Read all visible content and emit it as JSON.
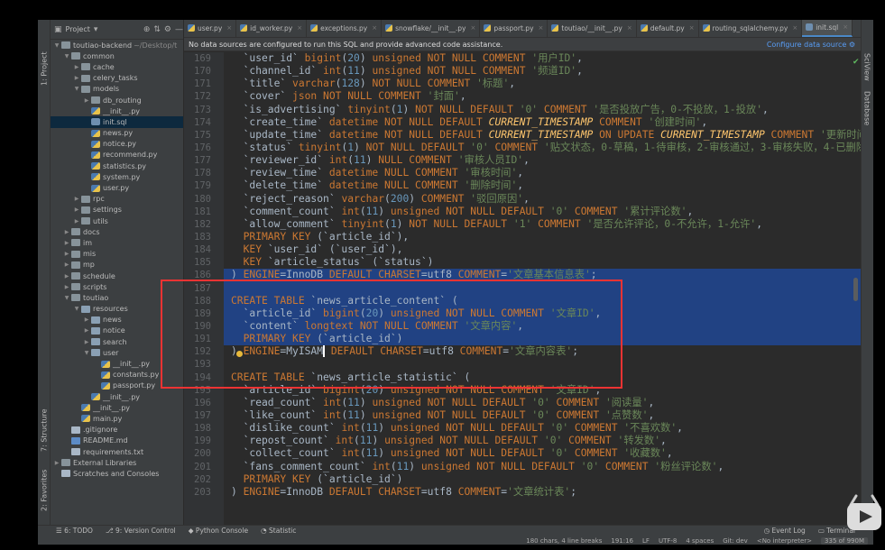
{
  "sidebar_vtabs": {
    "project": "1: Project",
    "structure": "7: Structure",
    "favorites": "2: Favorites"
  },
  "right_vtabs": {
    "sciview": "SciView",
    "database": "Database"
  },
  "project": {
    "title": "Project",
    "tree": [
      {
        "label": "toutiao-backend",
        "suffix": "~/Desktop/t",
        "depth": 0,
        "arrow": "open",
        "icon": "folder"
      },
      {
        "label": "common",
        "depth": 1,
        "arrow": "open",
        "icon": "folder"
      },
      {
        "label": "cache",
        "depth": 2,
        "arrow": "closed",
        "icon": "folder"
      },
      {
        "label": "celery_tasks",
        "depth": 2,
        "arrow": "closed",
        "icon": "folder"
      },
      {
        "label": "models",
        "depth": 2,
        "arrow": "open",
        "icon": "folder"
      },
      {
        "label": "db_routing",
        "depth": 3,
        "arrow": "closed",
        "icon": "folder"
      },
      {
        "label": "__init__.py",
        "depth": 3,
        "arrow": "",
        "icon": "py"
      },
      {
        "label": "init.sql",
        "depth": 3,
        "arrow": "",
        "icon": "sql",
        "selected": true
      },
      {
        "label": "news.py",
        "depth": 3,
        "arrow": "",
        "icon": "py"
      },
      {
        "label": "notice.py",
        "depth": 3,
        "arrow": "",
        "icon": "py"
      },
      {
        "label": "recommend.py",
        "depth": 3,
        "arrow": "",
        "icon": "py"
      },
      {
        "label": "statistics.py",
        "depth": 3,
        "arrow": "",
        "icon": "py"
      },
      {
        "label": "system.py",
        "depth": 3,
        "arrow": "",
        "icon": "py"
      },
      {
        "label": "user.py",
        "depth": 3,
        "arrow": "",
        "icon": "py"
      },
      {
        "label": "rpc",
        "depth": 2,
        "arrow": "closed",
        "icon": "folder"
      },
      {
        "label": "settings",
        "depth": 2,
        "arrow": "closed",
        "icon": "folder"
      },
      {
        "label": "utils",
        "depth": 2,
        "arrow": "closed",
        "icon": "folder"
      },
      {
        "label": "docs",
        "depth": 1,
        "arrow": "closed",
        "icon": "folder"
      },
      {
        "label": "im",
        "depth": 1,
        "arrow": "closed",
        "icon": "folder"
      },
      {
        "label": "mis",
        "depth": 1,
        "arrow": "closed",
        "icon": "folder"
      },
      {
        "label": "mp",
        "depth": 1,
        "arrow": "closed",
        "icon": "folder"
      },
      {
        "label": "schedule",
        "depth": 1,
        "arrow": "closed",
        "icon": "folder"
      },
      {
        "label": "scripts",
        "depth": 1,
        "arrow": "closed",
        "icon": "folder"
      },
      {
        "label": "toutiao",
        "depth": 1,
        "arrow": "open",
        "icon": "folder"
      },
      {
        "label": "resources",
        "depth": 2,
        "arrow": "open",
        "icon": "pkg"
      },
      {
        "label": "news",
        "depth": 3,
        "arrow": "closed",
        "icon": "pkg"
      },
      {
        "label": "notice",
        "depth": 3,
        "arrow": "closed",
        "icon": "pkg"
      },
      {
        "label": "search",
        "depth": 3,
        "arrow": "closed",
        "icon": "pkg"
      },
      {
        "label": "user",
        "depth": 3,
        "arrow": "open",
        "icon": "pkg"
      },
      {
        "label": "__init__.py",
        "depth": 4,
        "arrow": "",
        "icon": "py"
      },
      {
        "label": "constants.py",
        "depth": 4,
        "arrow": "",
        "icon": "py"
      },
      {
        "label": "passport.py",
        "depth": 4,
        "arrow": "",
        "icon": "py"
      },
      {
        "label": "__init__.py",
        "depth": 3,
        "arrow": "",
        "icon": "py"
      },
      {
        "label": "__init__.py",
        "depth": 2,
        "arrow": "",
        "icon": "py"
      },
      {
        "label": "main.py",
        "depth": 2,
        "arrow": "",
        "icon": "py"
      },
      {
        "label": ".gitignore",
        "depth": 1,
        "arrow": "",
        "icon": "txt"
      },
      {
        "label": "README.md",
        "depth": 1,
        "arrow": "",
        "icon": "md"
      },
      {
        "label": "requirements.txt",
        "depth": 1,
        "arrow": "",
        "icon": "txt"
      },
      {
        "label": "External Libraries",
        "depth": 0,
        "arrow": "closed",
        "icon": "lib"
      },
      {
        "label": "Scratches and Consoles",
        "depth": 0,
        "arrow": "",
        "icon": "scratch"
      }
    ]
  },
  "tabs": [
    "user.py",
    "id_worker.py",
    "exceptions.py",
    "snowflake/__init__.py",
    "passport.py",
    "toutiao/__init__.py",
    "default.py",
    "routing_sqlalchemy.py",
    "init.sql"
  ],
  "active_tab": 8,
  "banner": {
    "message": "No data sources are configured to run this SQL and provide advanced code assistance.",
    "link": "Configure data source"
  },
  "first_line_number": 169,
  "code_lines": [
    [
      [
        "id",
        "  `user_id` "
      ],
      [
        "kw",
        "bigint"
      ],
      [
        "id",
        "("
      ],
      [
        "num",
        "20"
      ],
      [
        "id",
        ") "
      ],
      [
        "kw",
        "unsigned NOT NULL COMMENT "
      ],
      [
        "str",
        "'用户ID'"
      ],
      [
        "id",
        ",",
        ""
      ]
    ],
    [
      [
        "id",
        "  `channel_id` "
      ],
      [
        "kw",
        "int"
      ],
      [
        "id",
        "("
      ],
      [
        "num",
        "11"
      ],
      [
        "id",
        ") "
      ],
      [
        "kw",
        "unsigned NOT NULL COMMENT "
      ],
      [
        "str",
        "'频道ID'"
      ],
      [
        "id",
        ","
      ]
    ],
    [
      [
        "id",
        "  `title` "
      ],
      [
        "kw",
        "varchar"
      ],
      [
        "id",
        "("
      ],
      [
        "num",
        "128"
      ],
      [
        "id",
        ") "
      ],
      [
        "kw",
        "NOT NULL COMMENT "
      ],
      [
        "str",
        "'标题'"
      ],
      [
        "id",
        ","
      ]
    ],
    [
      [
        "id",
        "  `cover` "
      ],
      [
        "kw",
        "json NOT NULL COMMENT "
      ],
      [
        "str",
        "'封面'"
      ],
      [
        "id",
        ","
      ]
    ],
    [
      [
        "id",
        "  `is_advertising` "
      ],
      [
        "kw",
        "tinyint"
      ],
      [
        "id",
        "("
      ],
      [
        "num",
        "1"
      ],
      [
        "id",
        ") "
      ],
      [
        "kw",
        "NOT NULL DEFAULT "
      ],
      [
        "str",
        "'0'"
      ],
      [
        "kw",
        " COMMENT "
      ],
      [
        "str",
        "'是否投放广告，0-不投放，1-投放'"
      ],
      [
        "id",
        ","
      ]
    ],
    [
      [
        "id",
        "  `create_time` "
      ],
      [
        "kw",
        "datetime NOT NULL DEFAULT "
      ],
      [
        "fn",
        "CURRENT_TIMESTAMP"
      ],
      [
        "kw",
        " COMMENT "
      ],
      [
        "str",
        "'创建时间'"
      ],
      [
        "id",
        ","
      ]
    ],
    [
      [
        "id",
        "  `update_time` "
      ],
      [
        "kw",
        "datetime NOT NULL DEFAULT "
      ],
      [
        "fn",
        "CURRENT_TIMESTAMP"
      ],
      [
        "kw",
        " ON UPDATE "
      ],
      [
        "fn",
        "CURRENT_TIMESTAMP"
      ],
      [
        "kw",
        " COMMENT "
      ],
      [
        "str",
        "'更新时间'"
      ]
    ],
    [
      [
        "id",
        "  `status` "
      ],
      [
        "kw",
        "tinyint"
      ],
      [
        "id",
        "("
      ],
      [
        "num",
        "1"
      ],
      [
        "id",
        ") "
      ],
      [
        "kw",
        "NOT NULL DEFAULT "
      ],
      [
        "str",
        "'0'"
      ],
      [
        "kw",
        " COMMENT "
      ],
      [
        "str",
        "'贴文状态，0-草稿，1-待审核，2-审核通过，3-审核失败，4-已删除'"
      ]
    ],
    [
      [
        "id",
        "  `reviewer_id` "
      ],
      [
        "kw",
        "int"
      ],
      [
        "id",
        "("
      ],
      [
        "num",
        "11"
      ],
      [
        "id",
        ") "
      ],
      [
        "kw",
        "NULL COMMENT "
      ],
      [
        "str",
        "'审核人员ID'"
      ],
      [
        "id",
        ","
      ]
    ],
    [
      [
        "id",
        "  `review_time` "
      ],
      [
        "kw",
        "datetime NULL COMMENT "
      ],
      [
        "str",
        "'审核时间'"
      ],
      [
        "id",
        ","
      ]
    ],
    [
      [
        "id",
        "  `delete_time` "
      ],
      [
        "kw",
        "datetime NULL COMMENT "
      ],
      [
        "str",
        "'删除时间'"
      ],
      [
        "id",
        ","
      ]
    ],
    [
      [
        "id",
        "  `reject_reason` "
      ],
      [
        "kw",
        "varchar"
      ],
      [
        "id",
        "("
      ],
      [
        "num",
        "200"
      ],
      [
        "id",
        ") "
      ],
      [
        "kw",
        "COMMENT "
      ],
      [
        "str",
        "'驳回原因'"
      ],
      [
        "id",
        ","
      ]
    ],
    [
      [
        "id",
        "  `comment_count` "
      ],
      [
        "kw",
        "int"
      ],
      [
        "id",
        "("
      ],
      [
        "num",
        "11"
      ],
      [
        "id",
        ") "
      ],
      [
        "kw",
        "unsigned NOT NULL DEFAULT "
      ],
      [
        "str",
        "'0'"
      ],
      [
        "kw",
        " COMMENT "
      ],
      [
        "str",
        "'累计评论数'"
      ],
      [
        "id",
        ","
      ]
    ],
    [
      [
        "id",
        "  `allow_comment` "
      ],
      [
        "kw",
        "tinyint"
      ],
      [
        "id",
        "("
      ],
      [
        "num",
        "1"
      ],
      [
        "id",
        ") "
      ],
      [
        "kw",
        "NOT NULL DEFAULT "
      ],
      [
        "str",
        "'1'"
      ],
      [
        "kw",
        " COMMENT "
      ],
      [
        "str",
        "'是否允许评论，0-不允许，1-允许'"
      ],
      [
        "id",
        ","
      ]
    ],
    [
      [
        "kw",
        "  PRIMARY KEY "
      ],
      [
        "id",
        "(`article_id`),"
      ]
    ],
    [
      [
        "kw",
        "  KEY "
      ],
      [
        "id",
        "`user_id` (`user_id`),"
      ]
    ],
    [
      [
        "kw",
        "  KEY "
      ],
      [
        "id",
        "`article_status` (`status`)"
      ]
    ],
    [
      [
        "id",
        ") "
      ],
      [
        "kw",
        "ENGINE"
      ],
      [
        "id",
        "=InnoDB "
      ],
      [
        "kw",
        "DEFAULT CHARSET"
      ],
      [
        "id",
        "=utf8 "
      ],
      [
        "kw",
        "COMMENT"
      ],
      [
        "id",
        "="
      ],
      [
        "str",
        "'文章基本信息表'"
      ],
      [
        "id",
        ";"
      ]
    ],
    [
      [
        "id",
        ""
      ]
    ],
    [
      [
        "kw",
        "CREATE TABLE "
      ],
      [
        "id",
        "`news_article_content` ("
      ]
    ],
    [
      [
        "id",
        "  `article_id` "
      ],
      [
        "kw",
        "bigint"
      ],
      [
        "id",
        "("
      ],
      [
        "num",
        "20"
      ],
      [
        "id",
        ") "
      ],
      [
        "kw",
        "unsigned NOT NULL COMMENT "
      ],
      [
        "str",
        "'文章ID'"
      ],
      [
        "id",
        ","
      ]
    ],
    [
      [
        "id",
        "  `content` "
      ],
      [
        "kw",
        "longtext NOT NULL COMMENT "
      ],
      [
        "str",
        "'文章内容'"
      ],
      [
        "id",
        ","
      ]
    ],
    [
      [
        "kw",
        "  PRIMARY KEY "
      ],
      [
        "id",
        "(`article_id`)"
      ]
    ],
    [
      [
        "id",
        ") "
      ],
      [
        "kw",
        "ENGINE"
      ],
      [
        "id",
        "=MyISAM"
      ],
      [
        "caret",
        ""
      ],
      [
        "kw",
        " DEFAULT CHARSET"
      ],
      [
        "id",
        "=utf8 "
      ],
      [
        "kw",
        "COMMENT"
      ],
      [
        "id",
        "="
      ],
      [
        "str",
        "'文章内容表'"
      ],
      [
        "id",
        ";"
      ]
    ],
    [
      [
        "id",
        ""
      ]
    ],
    [
      [
        "kw",
        "CREATE TABLE "
      ],
      [
        "id",
        "`news_article_statistic` ("
      ]
    ],
    [
      [
        "id",
        "  `article_id` "
      ],
      [
        "kw",
        "bigint"
      ],
      [
        "id",
        "("
      ],
      [
        "num",
        "20"
      ],
      [
        "id",
        ") "
      ],
      [
        "kw",
        "unsigned NOT NULL COMMENT "
      ],
      [
        "str",
        "'文章ID'"
      ],
      [
        "id",
        ","
      ]
    ],
    [
      [
        "id",
        "  `read_count` "
      ],
      [
        "kw",
        "int"
      ],
      [
        "id",
        "("
      ],
      [
        "num",
        "11"
      ],
      [
        "id",
        ") "
      ],
      [
        "kw",
        "unsigned NOT NULL DEFAULT "
      ],
      [
        "str",
        "'0'"
      ],
      [
        "kw",
        " COMMENT "
      ],
      [
        "str",
        "'阅读量'"
      ],
      [
        "id",
        ","
      ]
    ],
    [
      [
        "id",
        "  `like_count` "
      ],
      [
        "kw",
        "int"
      ],
      [
        "id",
        "("
      ],
      [
        "num",
        "11"
      ],
      [
        "id",
        ") "
      ],
      [
        "kw",
        "unsigned NOT NULL DEFAULT "
      ],
      [
        "str",
        "'0'"
      ],
      [
        "kw",
        " COMMENT "
      ],
      [
        "str",
        "'点赞数'"
      ],
      [
        "id",
        ","
      ]
    ],
    [
      [
        "id",
        "  `dislike_count` "
      ],
      [
        "kw",
        "int"
      ],
      [
        "id",
        "("
      ],
      [
        "num",
        "11"
      ],
      [
        "id",
        ") "
      ],
      [
        "kw",
        "unsigned NOT NULL DEFAULT "
      ],
      [
        "str",
        "'0'"
      ],
      [
        "kw",
        " COMMENT "
      ],
      [
        "str",
        "'不喜欢数'"
      ],
      [
        "id",
        ","
      ]
    ],
    [
      [
        "id",
        "  `repost_count` "
      ],
      [
        "kw",
        "int"
      ],
      [
        "id",
        "("
      ],
      [
        "num",
        "11"
      ],
      [
        "id",
        ") "
      ],
      [
        "kw",
        "unsigned NOT NULL DEFAULT "
      ],
      [
        "str",
        "'0'"
      ],
      [
        "kw",
        " COMMENT "
      ],
      [
        "str",
        "'转发数'"
      ],
      [
        "id",
        ","
      ]
    ],
    [
      [
        "id",
        "  `collect_count` "
      ],
      [
        "kw",
        "int"
      ],
      [
        "id",
        "("
      ],
      [
        "num",
        "11"
      ],
      [
        "id",
        ") "
      ],
      [
        "kw",
        "unsigned NOT NULL DEFAULT "
      ],
      [
        "str",
        "'0'"
      ],
      [
        "kw",
        " COMMENT "
      ],
      [
        "str",
        "'收藏数'"
      ],
      [
        "id",
        ","
      ]
    ],
    [
      [
        "id",
        "  `fans_comment_count` "
      ],
      [
        "kw",
        "int"
      ],
      [
        "id",
        "("
      ],
      [
        "num",
        "11"
      ],
      [
        "id",
        ") "
      ],
      [
        "kw",
        "unsigned NOT NULL DEFAULT "
      ],
      [
        "str",
        "'0'"
      ],
      [
        "kw",
        " COMMENT "
      ],
      [
        "str",
        "'粉丝评论数'"
      ],
      [
        "id",
        ","
      ]
    ],
    [
      [
        "kw",
        "  PRIMARY KEY "
      ],
      [
        "id",
        "(`article_id`)"
      ]
    ],
    [
      [
        "id",
        ") "
      ],
      [
        "kw",
        "ENGINE"
      ],
      [
        "id",
        "=InnoDB "
      ],
      [
        "kw",
        "DEFAULT CHARSET"
      ],
      [
        "id",
        "=utf8 "
      ],
      [
        "kw",
        "COMMENT"
      ],
      [
        "id",
        "="
      ],
      [
        "str",
        "'文章统计表'"
      ],
      [
        "id",
        ";"
      ]
    ]
  ],
  "selected_line_offsets": [
    17,
    18,
    19,
    20,
    21,
    22
  ],
  "tool_windows": {
    "todo": "6: TODO",
    "vcs": "9: Version Control",
    "python_console": "Python Console",
    "statistic": "Statistic",
    "event_log": "Event Log",
    "terminal": "Terminal"
  },
  "status": {
    "selection": "180 chars, 4 line breaks",
    "position": "191:16",
    "line_sep": "LF",
    "encoding": "UTF-8",
    "indent": "4 spaces",
    "git": "Git: dev",
    "interpreter": "<No interpreter>",
    "memory": "335 of 990M"
  },
  "colors": {
    "keyword": "#cc7832",
    "string": "#6a8759",
    "number": "#6897bb",
    "function": "#ffc66d",
    "selection": "#214283",
    "highlight_box": "#e33333"
  }
}
